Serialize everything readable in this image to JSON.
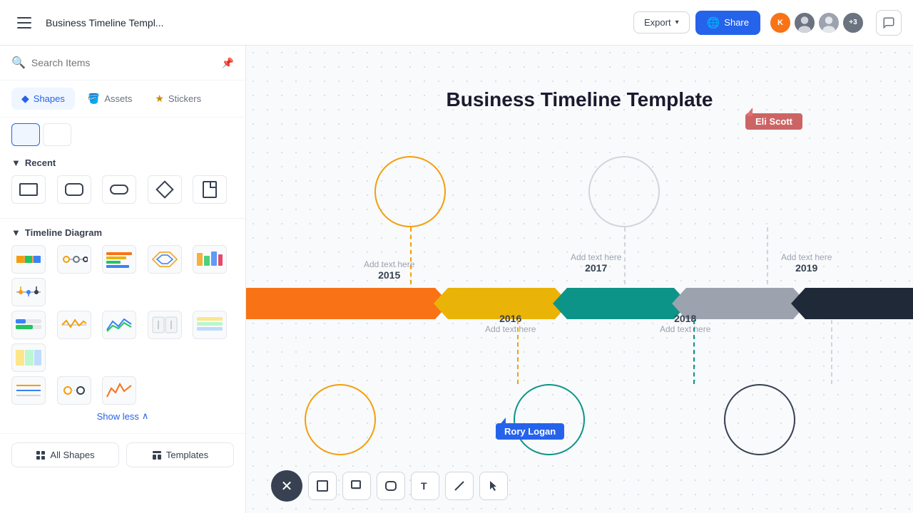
{
  "header": {
    "menu_label": "Menu",
    "doc_title": "Business Timeline Templ...",
    "export_label": "Export",
    "share_label": "Share",
    "avatar_extra": "+3",
    "comment_icon": "💬"
  },
  "sidebar": {
    "search_placeholder": "Search Items",
    "tabs": [
      {
        "id": "shapes",
        "label": "Shapes",
        "icon": "◆",
        "active": true
      },
      {
        "id": "assets",
        "label": "Assets",
        "icon": "🪣"
      },
      {
        "id": "stickers",
        "label": "Stickers",
        "icon": "★"
      }
    ],
    "recent_label": "Recent",
    "timeline_label": "Timeline Diagram",
    "show_less_label": "Show less",
    "all_shapes_label": "All Shapes",
    "templates_label": "Templates"
  },
  "canvas": {
    "title": "Business Timeline Template",
    "labels": {
      "add_text": "Add text here",
      "y2015": "2015",
      "y2016": "2016",
      "y2016_text": "Add text here",
      "y2017": "2017",
      "y2018": "2018",
      "y2018_text": "Add text here",
      "y2019": "2019"
    }
  },
  "cursors": {
    "rory": "Rory Logan",
    "eli": "Eli Scott"
  },
  "toolbar": {
    "close_icon": "✕",
    "rect_icon": "▭",
    "shadow_rect_icon": "▬",
    "rounded_rect_icon": "▢",
    "text_icon": "T",
    "line_icon": "╱",
    "cursor_icon": "↖"
  }
}
